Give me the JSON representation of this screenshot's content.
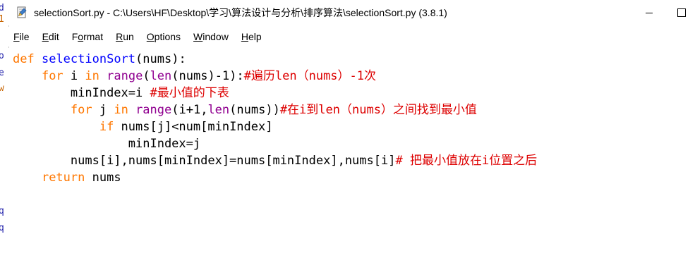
{
  "window": {
    "title": "selectionSort.py - C:\\Users\\HF\\Desktop\\学习\\算法设计与分析\\排序算法\\selectionSort.py (3.8.1)"
  },
  "menu": {
    "items": [
      {
        "mnemonic": "F",
        "rest": "ile"
      },
      {
        "mnemonic": "E",
        "rest": "dit"
      },
      {
        "pre": "F",
        "mnemonic": "o",
        "rest": "rmat"
      },
      {
        "mnemonic": "R",
        "rest": "un"
      },
      {
        "mnemonic": "O",
        "rest": "ptions"
      },
      {
        "mnemonic": "W",
        "rest": "indow"
      },
      {
        "mnemonic": "H",
        "rest": "elp"
      }
    ]
  },
  "left_strip": {
    "fragments": [
      "d",
      "1",
      "o",
      "e",
      "w",
      "q",
      "q"
    ]
  },
  "code": {
    "line1": {
      "kw": "def",
      "fn": "selectionSort",
      "rest": "(nums):"
    },
    "line2": {
      "indent": "    ",
      "kw1": "for",
      "t1": " i ",
      "kw2": "in",
      "t2": " ",
      "bi1": "range",
      "t3": "(",
      "bi2": "len",
      "t4": "(nums)-1):",
      "cm": "#遍历len（nums）-1次"
    },
    "line3": {
      "indent": "        ",
      "text": "minIndex=i ",
      "cm": "#最小值的下表"
    },
    "line4": {
      "indent": "        ",
      "kw1": "for",
      "t1": " j ",
      "kw2": "in",
      "t2": " ",
      "bi1": "range",
      "t3": "(i+1,",
      "bi2": "len",
      "t4": "(nums))",
      "cm": "#在i到len（nums）之间找到最小值"
    },
    "line5": {
      "indent": "            ",
      "kw": "if",
      "text": " nums[j]<num[minIndex]"
    },
    "line6": {
      "indent": "                ",
      "text": "minIndex=j"
    },
    "line7": {
      "indent": "        ",
      "text": "nums[i],nums[minIndex]=nums[minIndex],nums[i]",
      "cm": "# 把最小值放在i位置之后"
    },
    "line8": {
      "indent": "    ",
      "kw": "return",
      "text": " nums"
    }
  },
  "colors": {
    "keyword": "#ff7700",
    "def_name": "#0000ff",
    "builtin": "#900090",
    "comment": "#dd0000"
  },
  "icons": {
    "app": "idle-python-file-icon",
    "minimize": "minimize-icon",
    "maximize": "maximize-icon"
  }
}
